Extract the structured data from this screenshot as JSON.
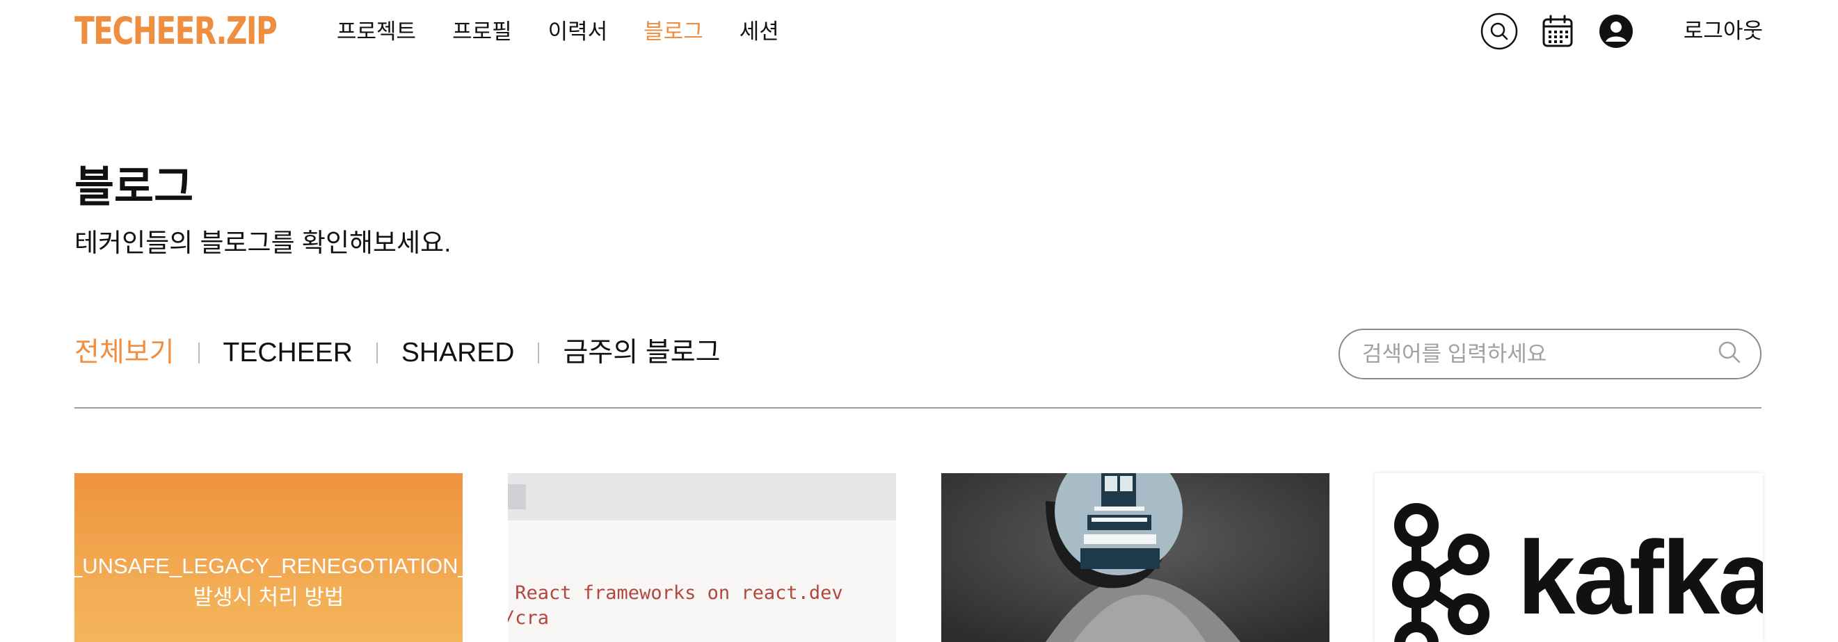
{
  "header": {
    "logo": "TECHEER.ZIP",
    "nav": [
      "프로젝트",
      "프로필",
      "이력서",
      "블로그",
      "세션"
    ],
    "active_nav": "블로그",
    "icons": [
      "search-icon",
      "calendar-icon",
      "user-icon"
    ],
    "logout_label": "로그아웃"
  },
  "page": {
    "title": "블로그",
    "subtitle": "테커인들의 블로그를 확인해보세요."
  },
  "filters": {
    "items": [
      "전체보기",
      "TECHEER",
      "SHARED",
      "금주의 블로그"
    ],
    "active": "전체보기"
  },
  "search": {
    "placeholder": "검색어를 입력하세요"
  },
  "cards": [
    {
      "thumb_line1": "_UNSAFE_LEGACY_RENEGOTIATION_D",
      "thumb_line2": "발생시 처리 방법"
    },
    {
      "thumb_line1": " React frameworks on react.dev",
      "thumb_line2": "/cra"
    },
    {
      "thumb_image": "photo-of-man-with-lighthouse-circle"
    },
    {
      "thumb_word": "kafka"
    }
  ],
  "colors": {
    "accent": "#ef8e3e",
    "text": "#111111",
    "divider": "#9e9e9e"
  }
}
